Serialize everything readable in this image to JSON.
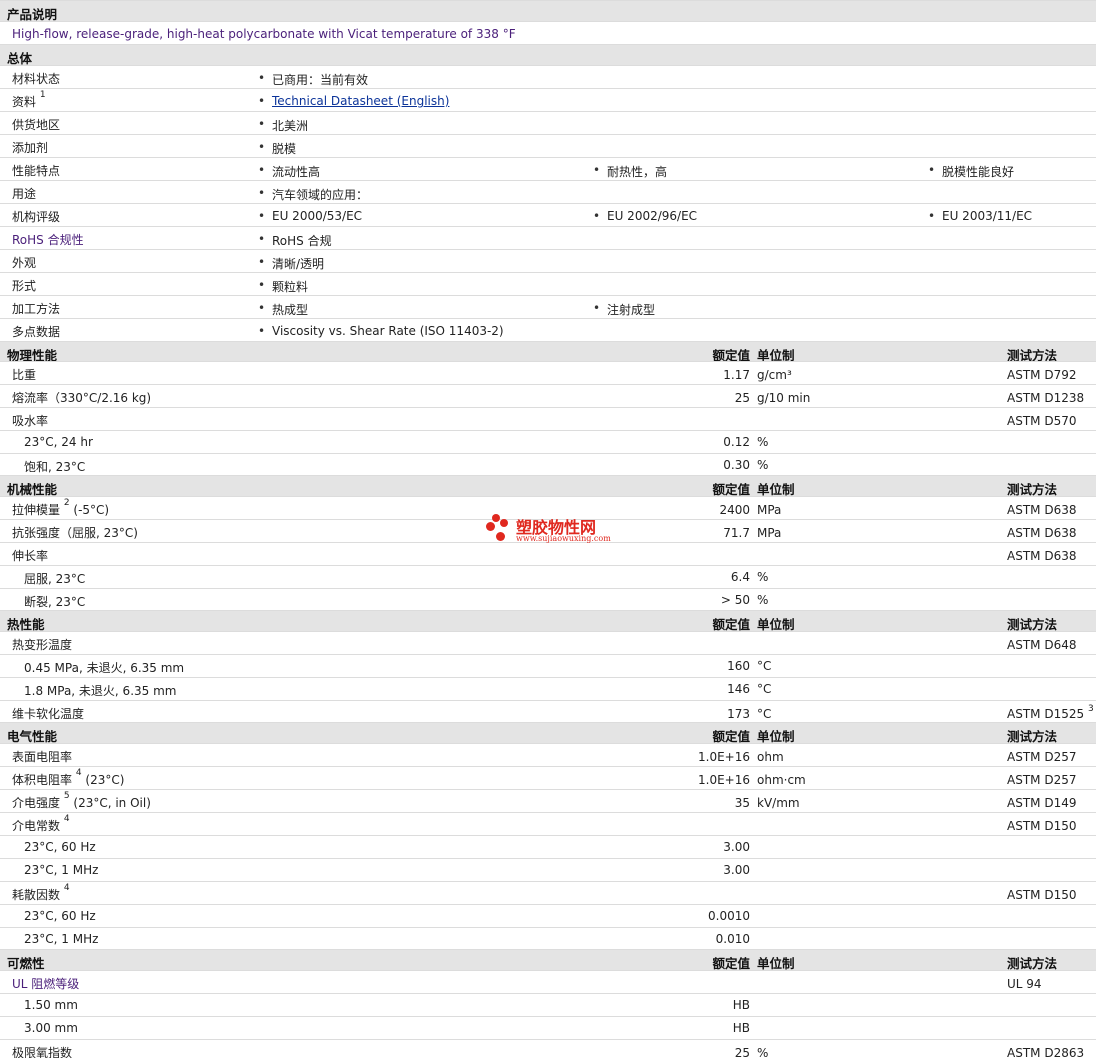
{
  "product_description": {
    "heading": "产品说明",
    "text": "High-flow, release-grade, high-heat polycarbonate with Vicat temperature of 338 °F"
  },
  "general": {
    "heading": "总体",
    "rows": [
      {
        "label": "材料状态",
        "values": [
          "已商用：当前有效"
        ]
      },
      {
        "label": "资料",
        "sup": "1",
        "values": [
          "Technical Datasheet (English)"
        ],
        "link": true
      },
      {
        "label": "供货地区",
        "values": [
          "北美洲"
        ]
      },
      {
        "label": "添加剂",
        "values": [
          "脱模"
        ]
      },
      {
        "label": "性能特点",
        "values": [
          "流动性高",
          "耐热性，高",
          "脱模性能良好"
        ]
      },
      {
        "label": "用途",
        "values": [
          "汽车领域的应用："
        ]
      },
      {
        "label": "机构评级",
        "values": [
          "EU 2000/53/EC",
          "EU 2002/96/EC",
          "EU 2003/11/EC"
        ]
      },
      {
        "label": "RoHS 合规性",
        "values": [
          "RoHS 合规"
        ]
      },
      {
        "label": "外观",
        "values": [
          "清晰/透明"
        ]
      },
      {
        "label": "形式",
        "values": [
          "颗粒料"
        ]
      },
      {
        "label": "加工方法",
        "values": [
          "热成型",
          "注射成型"
        ]
      },
      {
        "label": "多点数据",
        "values": [
          "Viscosity vs. Shear Rate (ISO 11403-2)"
        ]
      }
    ]
  },
  "columns": {
    "value": "额定值",
    "unit": "单位制",
    "method": "测试方法"
  },
  "physical": {
    "heading": "物理性能",
    "rows": [
      {
        "label": "比重",
        "value": "1.17",
        "unit": "g/cm³",
        "method": "ASTM D792"
      },
      {
        "label": "熔流率（330°C/2.16 kg)",
        "value": "25",
        "unit": "g/10 min",
        "method": "ASTM D1238"
      },
      {
        "label": "吸水率",
        "value": "",
        "unit": "",
        "method": "ASTM D570"
      },
      {
        "label": "23°C, 24 hr",
        "value": "0.12",
        "unit": "%",
        "method": "",
        "sub": true
      },
      {
        "label": "饱和, 23°C",
        "value": "0.30",
        "unit": "%",
        "method": "",
        "sub": true
      }
    ]
  },
  "mechanical": {
    "heading": "机械性能",
    "rows": [
      {
        "label": "拉伸模量",
        "sup": "2",
        "suffix": " (-5°C)",
        "value": "2400",
        "unit": "MPa",
        "method": "ASTM D638"
      },
      {
        "label": "抗张强度（屈服, 23°C)",
        "value": "71.7",
        "unit": "MPa",
        "method": "ASTM D638"
      },
      {
        "label": "伸长率",
        "value": "",
        "unit": "",
        "method": "ASTM D638"
      },
      {
        "label": "屈服, 23°C",
        "value": "6.4",
        "unit": "%",
        "method": "",
        "sub": true
      },
      {
        "label": "断裂, 23°C",
        "value": "> 50",
        "unit": "%",
        "method": "",
        "sub": true
      }
    ]
  },
  "thermal": {
    "heading": "热性能",
    "rows": [
      {
        "label": "热变形温度",
        "value": "",
        "unit": "",
        "method": "ASTM D648"
      },
      {
        "label": "0.45 MPa, 未退火, 6.35 mm",
        "value": "160",
        "unit": "°C",
        "method": "",
        "sub": true
      },
      {
        "label": "1.8 MPa, 未退火, 6.35 mm",
        "value": "146",
        "unit": "°C",
        "method": "",
        "sub": true
      },
      {
        "label": "维卡软化温度",
        "value": "173",
        "unit": "°C",
        "method": "ASTM D1525",
        "method_sup": "3"
      }
    ]
  },
  "electrical": {
    "heading": "电气性能",
    "rows": [
      {
        "label": "表面电阻率",
        "value": "1.0E+16",
        "unit": "ohm",
        "method": "ASTM D257"
      },
      {
        "label": "体积电阻率",
        "sup": "4",
        "suffix": " (23°C)",
        "value": "1.0E+16",
        "unit": "ohm·cm",
        "method": "ASTM D257"
      },
      {
        "label": "介电强度",
        "sup": "5",
        "suffix": " (23°C, in Oil)",
        "value": "35",
        "unit": "kV/mm",
        "method": "ASTM D149"
      },
      {
        "label": "介电常数",
        "sup": "4",
        "value": "",
        "unit": "",
        "method": "ASTM D150"
      },
      {
        "label": "23°C, 60 Hz",
        "value": "3.00",
        "unit": "",
        "method": "",
        "sub": true
      },
      {
        "label": "23°C, 1 MHz",
        "value": "3.00",
        "unit": "",
        "method": "",
        "sub": true
      },
      {
        "label": "耗散因数",
        "sup": "4",
        "value": "",
        "unit": "",
        "method": "ASTM D150"
      },
      {
        "label": "23°C, 60 Hz",
        "value": "0.0010",
        "unit": "",
        "method": "",
        "sub": true
      },
      {
        "label": "23°C, 1 MHz",
        "value": "0.010",
        "unit": "",
        "method": "",
        "sub": true
      }
    ]
  },
  "flammability": {
    "heading": "可燃性",
    "rows": [
      {
        "label": "UL 阻燃等级",
        "value": "",
        "unit": "",
        "method": "UL 94"
      },
      {
        "label": "1.50 mm",
        "value": "HB",
        "unit": "",
        "method": "",
        "sub": true
      },
      {
        "label": "3.00 mm",
        "value": "HB",
        "unit": "",
        "method": "",
        "sub": true
      },
      {
        "label": "极限氧指数",
        "value": "25",
        "unit": "%",
        "method": "ASTM D2863"
      }
    ]
  },
  "watermark": {
    "title": "塑胶物性网",
    "url": "www.sujiaowuxing.com",
    "color": "#e0281f"
  }
}
